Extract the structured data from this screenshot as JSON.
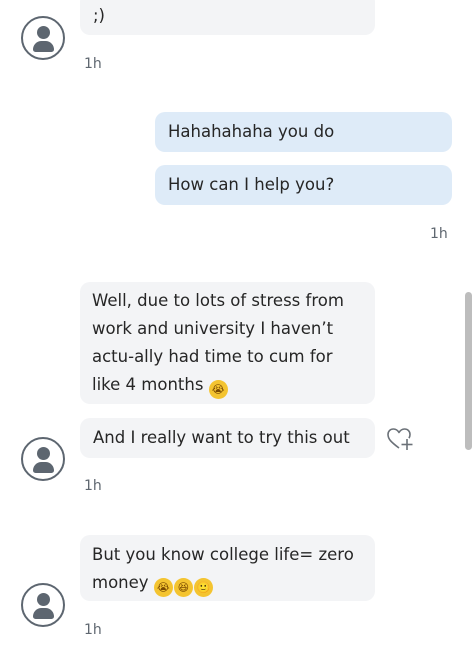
{
  "messages": [
    {
      "text": ";)"
    },
    {
      "text": "Hahahahaha you do"
    },
    {
      "text": "How can I help you?"
    },
    {
      "text": "Well, due to lots of stress from work and university I haven’t actu-ally had time to cum for like 4 months"
    },
    {
      "text": "And I really want to try this out"
    },
    {
      "text": "But you know college life= zero money"
    }
  ],
  "timestamps": [
    "1h",
    "1h",
    "1h",
    "1h"
  ],
  "emojis": {
    "crying": "😭",
    "laughing": "😆",
    "slight_smile": "🙂"
  },
  "icons": {
    "avatar": "user-avatar-icon",
    "react": "heart-plus-icon"
  },
  "colors": {
    "incoming_bubble": "#f3f4f6",
    "outgoing_bubble": "#deebf8",
    "avatar_stroke": "#5d6670"
  }
}
